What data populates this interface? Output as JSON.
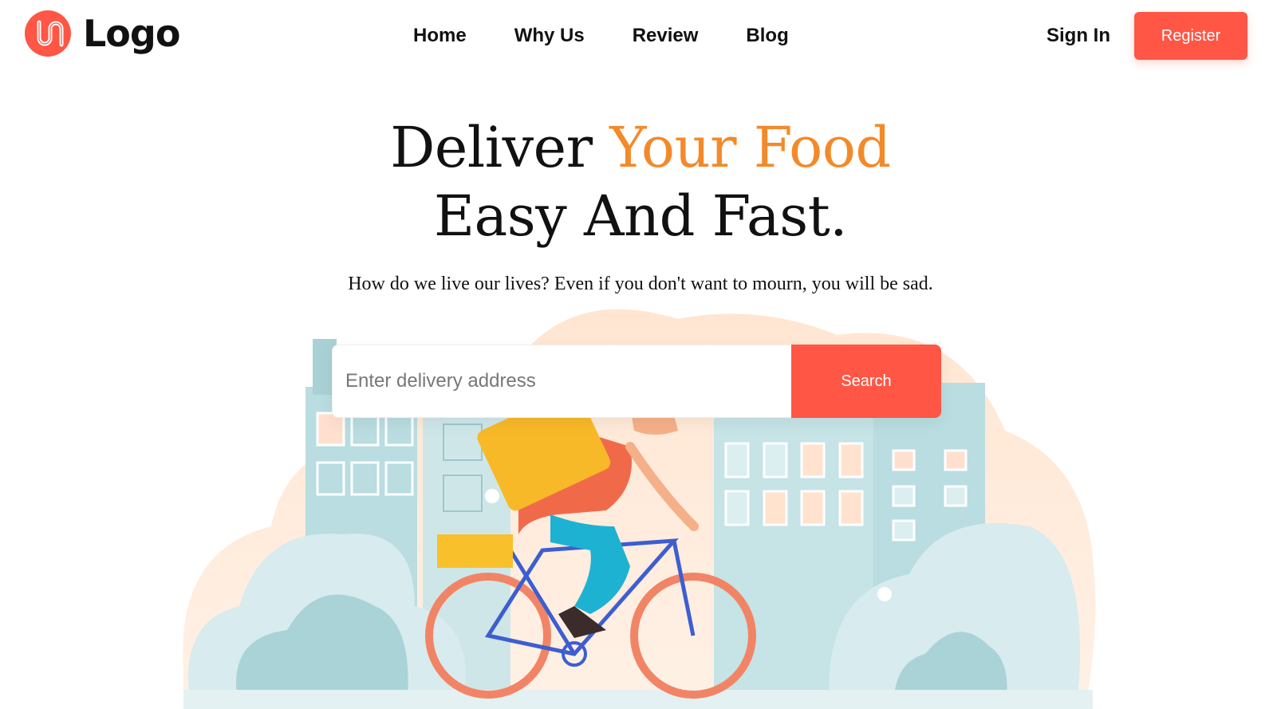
{
  "brand": {
    "name": "Logo",
    "accent_color": "#ff5645"
  },
  "nav": {
    "items": [
      {
        "label": "Home"
      },
      {
        "label": "Why Us"
      },
      {
        "label": "Review"
      },
      {
        "label": "Blog"
      }
    ]
  },
  "auth": {
    "sign_in": "Sign In",
    "register": "Register"
  },
  "hero": {
    "title_part1": "Deliver ",
    "title_highlight": "Your Food",
    "title_line2": "Easy And Fast.",
    "highlight_color": "#f38a2a",
    "subtitle": "How do we live our lives? Even if you don't want to mourn, you will be sad."
  },
  "search": {
    "placeholder": "Enter delivery address",
    "value": "",
    "button_label": "Search"
  },
  "illustration": {
    "icon": "delivery-cyclist-illustration"
  }
}
